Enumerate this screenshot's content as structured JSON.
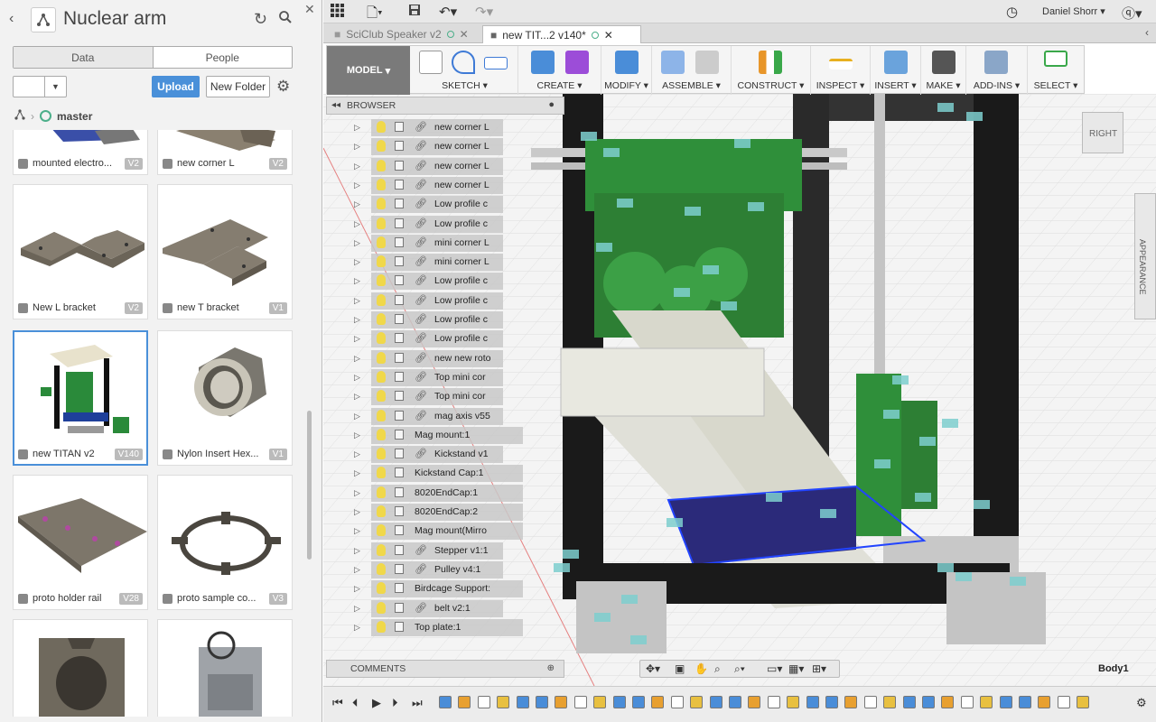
{
  "data_panel": {
    "title": "Nuclear arm",
    "tabs": [
      "Data",
      "People"
    ],
    "upload_label": "Upload",
    "new_folder_label": "New Folder",
    "branch": "master",
    "items": [
      {
        "name": "mounted electro...",
        "version": "V2"
      },
      {
        "name": "new corner L",
        "version": "V2"
      },
      {
        "name": "New L bracket",
        "version": "V2"
      },
      {
        "name": "new T bracket",
        "version": "V1"
      },
      {
        "name": "new TITAN v2",
        "version": "V140"
      },
      {
        "name": "Nylon Insert Hex...",
        "version": "V1"
      },
      {
        "name": "proto holder rail",
        "version": "V28"
      },
      {
        "name": "proto sample co...",
        "version": "V3"
      },
      {
        "name": "",
        "version": ""
      },
      {
        "name": "",
        "version": ""
      }
    ]
  },
  "user": {
    "name": "Daniel Shorr"
  },
  "doc_tabs": [
    {
      "label": "SciClub Speaker v2",
      "active": false
    },
    {
      "label": "new TIT...2 v140*",
      "active": true
    }
  ],
  "toolbar": {
    "model_label": "MODEL",
    "groups": [
      "SKETCH",
      "CREATE",
      "MODIFY",
      "ASSEMBLE",
      "CONSTRUCT",
      "INSPECT",
      "INSERT",
      "MAKE",
      "ADD-INS",
      "SELECT"
    ]
  },
  "browser": {
    "title": "BROWSER",
    "items": [
      {
        "name": "new corner L",
        "link": true
      },
      {
        "name": "new corner L",
        "link": true
      },
      {
        "name": "new corner L",
        "link": true
      },
      {
        "name": "new corner L",
        "link": true
      },
      {
        "name": "Low profile c",
        "link": true
      },
      {
        "name": "Low profile c",
        "link": true
      },
      {
        "name": "mini corner L",
        "link": true
      },
      {
        "name": "mini corner L",
        "link": true
      },
      {
        "name": "Low profile c",
        "link": true
      },
      {
        "name": "Low profile c",
        "link": true
      },
      {
        "name": "Low profile c",
        "link": true
      },
      {
        "name": "Low profile c",
        "link": true
      },
      {
        "name": "new new roto",
        "link": true
      },
      {
        "name": "Top mini cor",
        "link": true
      },
      {
        "name": "Top mini cor",
        "link": true
      },
      {
        "name": "mag axis v55",
        "link": true
      },
      {
        "name": "Mag mount:1",
        "link": false
      },
      {
        "name": "Kickstand v1",
        "link": true
      },
      {
        "name": "Kickstand Cap:1",
        "link": false
      },
      {
        "name": "8020EndCap:1",
        "link": false
      },
      {
        "name": "8020EndCap:2",
        "link": false
      },
      {
        "name": "Mag mount(Mirro",
        "link": false
      },
      {
        "name": "Stepper v1:1",
        "link": true
      },
      {
        "name": "Pulley v4:1",
        "link": true
      },
      {
        "name": "Birdcage Support:",
        "link": false
      },
      {
        "name": "belt v2:1",
        "link": true
      },
      {
        "name": "Top plate:1",
        "link": false
      }
    ]
  },
  "comments_label": "COMMENTS",
  "viewcube_label": "RIGHT",
  "appearance_label": "APPEARANCE",
  "selection_label": "Body1"
}
